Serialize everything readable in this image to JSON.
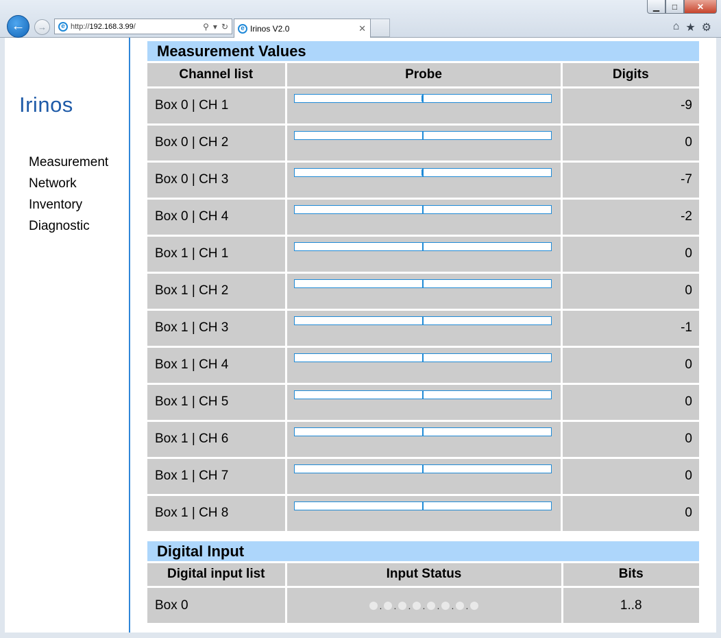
{
  "browser": {
    "url_prefix": "http://",
    "url_host": "192.168.3.99",
    "url_suffix": "/",
    "tab_title": "Irinos V2.0",
    "window_buttons": {
      "minimize": "▁",
      "maximize": "□",
      "close": "✕"
    },
    "icons": [
      "home-icon",
      "favorites-star-icon",
      "settings-gear-icon"
    ]
  },
  "sidebar": {
    "logo": "Irinos",
    "nav": [
      {
        "label": "Measurement"
      },
      {
        "label": "Network"
      },
      {
        "label": "Inventory"
      },
      {
        "label": "Diagnostic"
      }
    ]
  },
  "measurement": {
    "title": "Measurement Values",
    "headers": {
      "channel": "Channel list",
      "probe": "Probe",
      "digits": "Digits"
    },
    "rows": [
      {
        "channel": "Box 0 | CH 1",
        "digits": "-9",
        "probe_fraction": -0.01
      },
      {
        "channel": "Box 0 | CH 2",
        "digits": "0",
        "probe_fraction": 0
      },
      {
        "channel": "Box 0 | CH 3",
        "digits": "-7",
        "probe_fraction": -0.01
      },
      {
        "channel": "Box 0 | CH 4",
        "digits": "-2",
        "probe_fraction": 0
      },
      {
        "channel": "Box 1 | CH 1",
        "digits": "0",
        "probe_fraction": 0
      },
      {
        "channel": "Box 1 | CH 2",
        "digits": "0",
        "probe_fraction": 0
      },
      {
        "channel": "Box 1 | CH 3",
        "digits": "-1",
        "probe_fraction": 0
      },
      {
        "channel": "Box 1 | CH 4",
        "digits": "0",
        "probe_fraction": 0
      },
      {
        "channel": "Box 1 | CH 5",
        "digits": "0",
        "probe_fraction": 0
      },
      {
        "channel": "Box 1 | CH 6",
        "digits": "0",
        "probe_fraction": 0
      },
      {
        "channel": "Box 1 | CH 7",
        "digits": "0",
        "probe_fraction": 0
      },
      {
        "channel": "Box 1 | CH 8",
        "digits": "0",
        "probe_fraction": 0
      }
    ]
  },
  "digital": {
    "title": "Digital Input",
    "headers": {
      "list": "Digital input list",
      "status": "Input Status",
      "bits": "Bits"
    },
    "rows": [
      {
        "name": "Box 0",
        "bits": "1..8",
        "status": [
          0,
          0,
          0,
          0,
          0,
          0,
          0,
          0
        ]
      }
    ],
    "colors": {
      "off": "#e9e9e9",
      "on": "#3db83d"
    }
  },
  "colors": {
    "accent": "#2f86d8",
    "header_bg": "#add6fb",
    "cell_bg": "#cccccc",
    "logo": "#1f5ba8"
  }
}
